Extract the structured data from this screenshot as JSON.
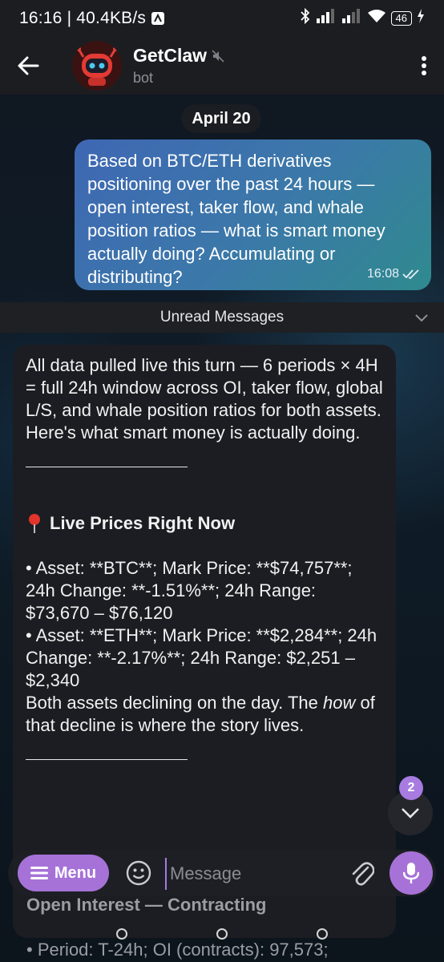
{
  "status": {
    "time": "16:16",
    "speed": "40.4KB/s",
    "battery": "46"
  },
  "header": {
    "name": "GetClaw",
    "subtitle": "bot"
  },
  "date_pill": "April 20",
  "outgoing": {
    "text": "Based on BTC/ETH derivatives positioning over the past 24 hours — open interest, taker flow, and whale position ratios — what is smart money actually doing? Accumulating or distributing?",
    "time": "16:08"
  },
  "unread_label": "Unread Messages",
  "incoming": {
    "intro": "All data pulled live this turn — 6 periods × 4H = full 24h window across OI, taker flow, global L/S, and whale position ratios for both assets. Here's what smart money is actually doing.",
    "section_icon": "pin-icon",
    "section_title": "Live Prices Right Now",
    "btc_line": "• Asset: **BTC**; Mark Price: **$74,757**; 24h Change: **-1.51%**; 24h Range: $73,670 – $76,120",
    "eth_line": "• Asset: **ETH**; Mark Price: **$2,284**; 24h Change: **-2.17%**; 24h Range: $2,251 – $2,340",
    "decline_pre": "Both assets declining on the day. The ",
    "decline_em": "how",
    "decline_post": " of that decline is where the story lives.",
    "oi_heading": "Open Interest — Contracting",
    "oi_line": "• Period: T-24h; OI (contracts): 97,573;"
  },
  "scroll_badge": "2",
  "composer": {
    "menu_label": "Menu",
    "placeholder": "Message"
  },
  "colors": {
    "accent": "#a672d8",
    "outgoing_bubble": "#3f67b4",
    "incoming_bubble": "#1b1d22"
  }
}
